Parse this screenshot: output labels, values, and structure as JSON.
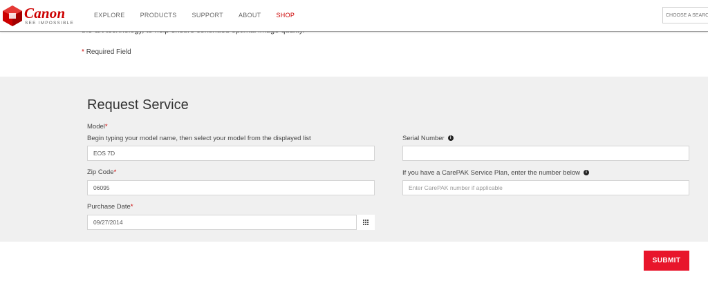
{
  "header": {
    "brand": "Canon",
    "tagline": "SEE IMPOSSIBLE",
    "nav": [
      "EXPLORE",
      "PRODUCTS",
      "SUPPORT",
      "ABOUT",
      "SHOP"
    ],
    "search_placeholder": "CHOOSE A SEARCH A"
  },
  "intro": {
    "cut_text": "the-art technology, to help ensure continued optimal image quality.",
    "required_star": "*",
    "required_note": "Required Field"
  },
  "form": {
    "title": "Request Service",
    "model_label": "Model",
    "model_hint": "Begin typing your model name, then select your model from the displayed list",
    "model_value": "EOS 7D",
    "zip_label": "Zip Code",
    "zip_value": "06095",
    "purchase_label": "Purchase Date",
    "purchase_value": "09/27/2014",
    "serial_label": "Serial Number",
    "serial_value": "",
    "carepak_label": "If you have a CarePAK Service Plan, enter the number below",
    "carepak_placeholder": "Enter CarePAK number if applicable",
    "required_star": "*",
    "info_glyph": "i",
    "submit_label": "SUBMIT"
  },
  "colors": {
    "brand_red": "#cc0000",
    "submit_red": "#e8152b",
    "panel_bg": "#f0f0f0"
  },
  "icons": [
    "canon-logo-icon",
    "info-icon",
    "calendar-icon"
  ]
}
